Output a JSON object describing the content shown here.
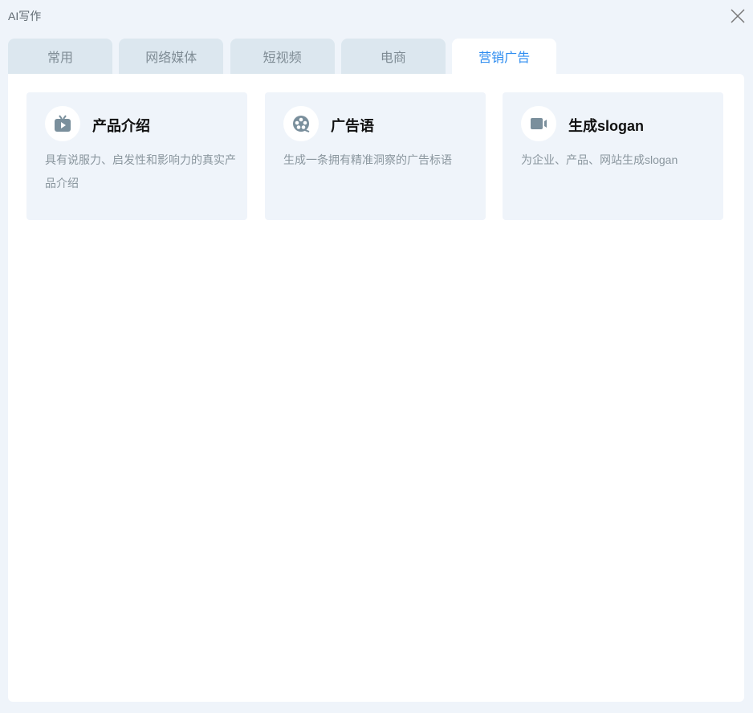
{
  "window": {
    "title": "AI写作"
  },
  "tabs": [
    {
      "label": "常用"
    },
    {
      "label": "网络媒体"
    },
    {
      "label": "短视频"
    },
    {
      "label": "电商"
    },
    {
      "label": "营销广告",
      "active": true
    }
  ],
  "cards": [
    {
      "title": "产品介绍",
      "desc": "具有说服力、启发性和影响力的真实产品介绍",
      "icon": "tv-play-icon"
    },
    {
      "title": "广告语",
      "desc": "生成一条拥有精准洞察的广告标语",
      "icon": "film-reel-icon"
    },
    {
      "title": "生成slogan",
      "desc": "为企业、产品、网站生成slogan",
      "icon": "video-camera-icon"
    }
  ],
  "colors": {
    "accent": "#2d8cf0",
    "icon": "#7a8f9c",
    "background": "#eff4fa"
  }
}
